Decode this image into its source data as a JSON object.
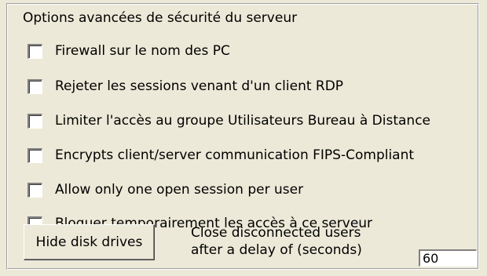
{
  "group": {
    "title": "Options avancées de sécurité du serveur"
  },
  "options": [
    {
      "label": "Firewall sur le nom des PC",
      "checked": false
    },
    {
      "label": "Rejeter les sessions venant d'un client RDP",
      "checked": false
    },
    {
      "label": "Limiter l'accès au groupe Utilisateurs Bureau à Distance",
      "checked": false
    },
    {
      "label": "Encrypts client/server communication FIPS-Compliant",
      "checked": false
    },
    {
      "label": "Allow only one open session per user",
      "checked": false
    },
    {
      "label": "Bloquer temporairement les accès à ce serveur",
      "checked": false
    }
  ],
  "hide_disk_drives": {
    "label": "Hide disk drives"
  },
  "disconnect_delay": {
    "label_line1": "Close disconnected users",
    "label_line2": "after a delay of (seconds)",
    "value": "60"
  },
  "colors": {
    "window_bg": "#ece9d8",
    "field_bg": "#ffffff"
  }
}
